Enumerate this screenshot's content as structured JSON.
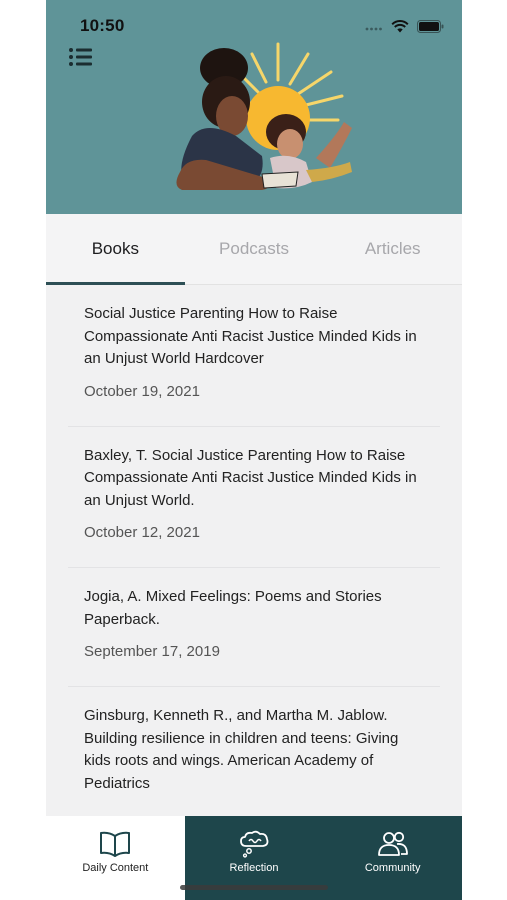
{
  "status_bar": {
    "time": "10:50"
  },
  "header": {
    "menu_icon": "hamburger-menu-icon",
    "illustration": "mother-and-child-with-sun-illustration",
    "background_color": "#5f9498"
  },
  "tabs": [
    {
      "label": "Books",
      "active": true
    },
    {
      "label": "Podcasts",
      "active": false
    },
    {
      "label": "Articles",
      "active": false
    }
  ],
  "list": {
    "items": [
      {
        "title": "Social Justice Parenting How to Raise Compassionate Anti Racist Justice Minded Kids in an Unjust World Hardcover",
        "date": "October 19, 2021"
      },
      {
        "title": "Baxley, T. Social Justice Parenting How to Raise Compassionate Anti Racist Justice Minded Kids in an Unjust World.",
        "date": "October 12, 2021"
      },
      {
        "title": "Jogia, A. Mixed Feelings: Poems and Stories Paperback.",
        "date": "September 17, 2019"
      },
      {
        "title": "Ginsburg, Kenneth R., and Martha M. Jablow. Building resilience in children and teens: Giving kids roots and wings. American Academy of Pediatrics",
        "date": ""
      }
    ]
  },
  "bottom_nav": [
    {
      "label": "Daily Content",
      "icon": "open-book-icon",
      "active": true
    },
    {
      "label": "Reflection",
      "icon": "thought-bubble-icon",
      "active": false
    },
    {
      "label": "Community",
      "icon": "people-icon",
      "active": false
    }
  ],
  "colors": {
    "header_teal": "#5f9498",
    "nav_dark_teal": "#1e464b",
    "tab_indicator": "#2d4f55"
  }
}
